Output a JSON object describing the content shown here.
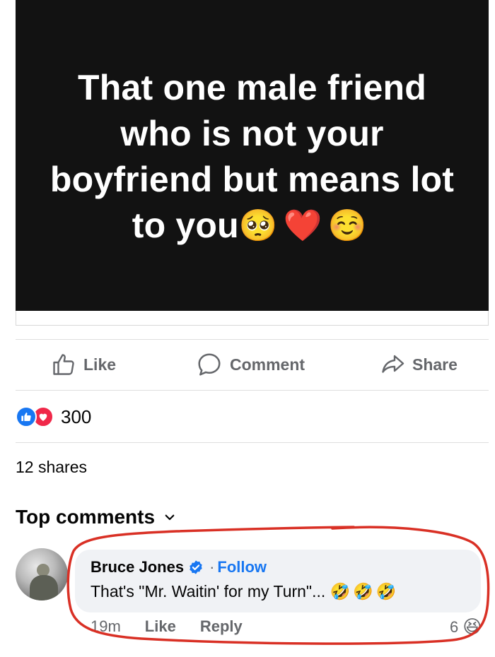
{
  "post": {
    "text_main": "That one male friend who is not your boyfriend but means lot to you",
    "text_emojis": "🥺❤️☺️"
  },
  "actions": {
    "like_label": "Like",
    "comment_label": "Comment",
    "share_label": "Share"
  },
  "stats": {
    "reaction_count": "300",
    "shares_text": "12 shares"
  },
  "comments_section": {
    "heading": "Top comments"
  },
  "comment": {
    "author": "Bruce Jones",
    "separator": "·",
    "follow_label": "Follow",
    "text": "That's \"Mr. Waitin' for my Turn\"...",
    "text_emojis": "🤣🤣🤣",
    "time": "19m",
    "like_label": "Like",
    "reply_label": "Reply",
    "reaction_count": "6",
    "reaction_emoji": "😆"
  },
  "colors": {
    "accent": "#1877f2",
    "love": "#f02849",
    "muted": "#65676b",
    "annotation": "#d93025"
  }
}
